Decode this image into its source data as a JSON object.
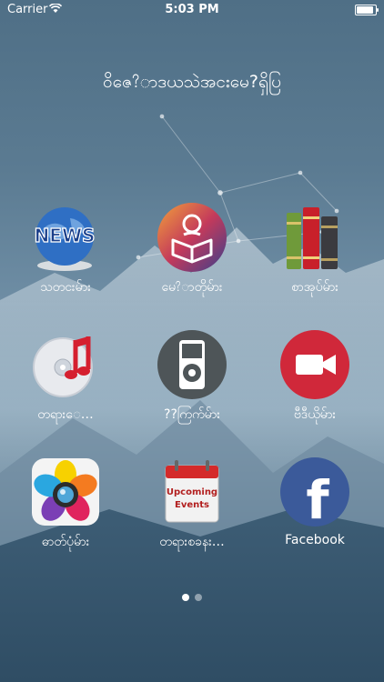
{
  "status": {
    "carrier": "Carrier",
    "time": "5:03 PM",
    "battery_level": 1.0
  },
  "title": "ဝိဇေ?ာဒယသဲအငးမေ?ရှိပြ",
  "apps": [
    {
      "label": "သတငးမ်ား",
      "icon": "news-globe-icon"
    },
    {
      "label": "မေ?ာတိုမ်ား",
      "icon": "reading-person-icon"
    },
    {
      "label": "စာအုပ်မ်ား",
      "icon": "books-icon"
    },
    {
      "label": "တရားေ…",
      "icon": "music-cd-icon"
    },
    {
      "label": "??ကြက်မ်ား",
      "icon": "ipod-icon"
    },
    {
      "label": "ဗီဒီယိုမ်ား",
      "icon": "video-camera-icon"
    },
    {
      "label": "ဓာတ်ပုံမ်ား",
      "icon": "photo-flower-icon"
    },
    {
      "label": "တရားစခနး…",
      "icon": "upcoming-events-calendar-icon"
    },
    {
      "label": "Facebook",
      "icon": "facebook-icon"
    }
  ],
  "upcoming_events_text": {
    "line1": "Upcoming",
    "line2": "Events"
  },
  "news_text": "NEWS",
  "facebook_letter": "f",
  "pager": {
    "current_page": 1,
    "total_pages": 2
  },
  "colors": {
    "video_red": "#d0283a",
    "ipod_gray": "#4e5558",
    "facebook_blue": "#3b5a9a"
  }
}
